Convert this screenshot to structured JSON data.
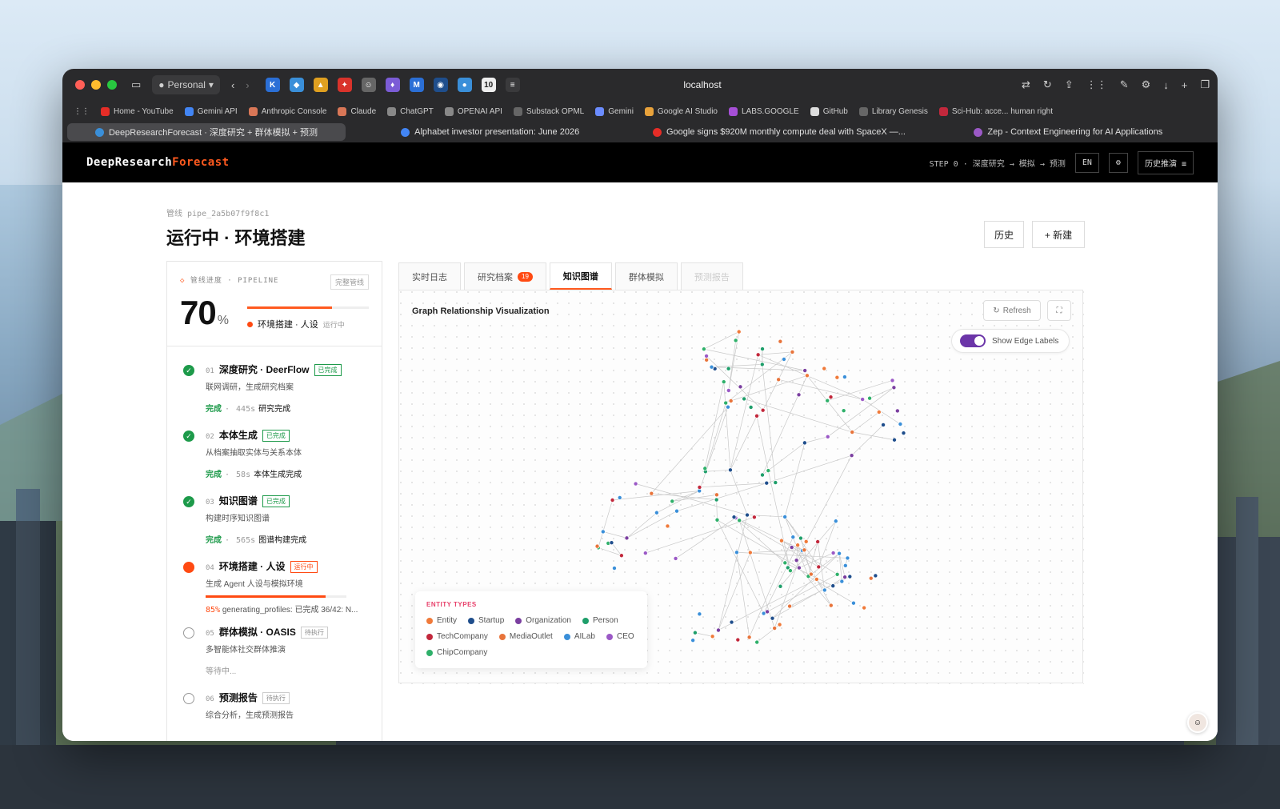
{
  "browser": {
    "profile": "Personal",
    "address": "localhost",
    "bookmarks": [
      "Home - YouTube",
      "Gemini API",
      "Anthropic Console",
      "Claude",
      "ChatGPT",
      "OPENAI API",
      "Substack OPML",
      "Gemini",
      "Google AI Studio",
      "LABS.GOOGLE",
      "GitHub",
      "Library Genesis",
      "Sci-Hub: acce... human right"
    ],
    "tabs": [
      "DeepResearchForecast · 深度研究 + 群体模拟 + 预测",
      "Alphabet investor presentation: June 2026",
      "Google signs $920M monthly compute deal with SpaceX —...",
      "Zep - Context Engineering for AI Applications"
    ]
  },
  "header": {
    "brand_a": "DeepResearch",
    "brand_b": "Forecast",
    "step": "STEP 0 · 深度研究 → 模拟 → 预测",
    "lang": "EN",
    "history_btn": "历史推演 ≡"
  },
  "page": {
    "pipe_id": "管线 pipe_2a5b07f9f8c1",
    "title": "运行中 · 环境搭建",
    "history": "历史",
    "new": "+  新建"
  },
  "pipeline": {
    "caption": "管线进度 · PIPELINE",
    "full_btn": "完整管线",
    "percent": "70",
    "percent_unit": "%",
    "progress_fraction": 0.7,
    "current": "环境搭建 · 人设",
    "current_status": "运行中",
    "steps": [
      {
        "num": "01",
        "title": "深度研究 · DeerFlow",
        "badge": "已完成",
        "desc": "联网调研，生成研究档案",
        "status": "完成",
        "secs": "445s",
        "note": "研究完成"
      },
      {
        "num": "02",
        "title": "本体生成",
        "badge": "已完成",
        "desc": "从档案抽取实体与关系本体",
        "status": "完成",
        "secs": "58s",
        "note": "本体生成完成"
      },
      {
        "num": "03",
        "title": "知识图谱",
        "badge": "已完成",
        "desc": "构建时序知识图谱",
        "status": "完成",
        "secs": "565s",
        "note": "图谱构建完成"
      },
      {
        "num": "04",
        "title": "环境搭建 · 人设",
        "badge": "运行中",
        "desc": "生成 Agent 人设与模拟环境",
        "pct": "85%",
        "progress_fraction": 0.85,
        "note": "generating_profiles: 已完成 36/42: N..."
      },
      {
        "num": "05",
        "title": "群体模拟 · OASIS",
        "badge": "待执行",
        "desc": "多智能体社交群体推演",
        "wait": "等待中..."
      },
      {
        "num": "06",
        "title": "预测报告",
        "badge": "待执行",
        "desc": "综合分析，生成预测报告"
      }
    ]
  },
  "panel": {
    "tabs": [
      "实时日志",
      "研究档案",
      "知识图谱",
      "群体模拟",
      "预测报告"
    ],
    "badge_count": "19",
    "graph_title": "Graph Relationship Visualization",
    "refresh": "Refresh",
    "edge_labels": "Show Edge Labels",
    "legend_title": "ENTITY TYPES",
    "legend": [
      {
        "name": "Entity",
        "color": "#f07a3a"
      },
      {
        "name": "Startup",
        "color": "#1f4e8c"
      },
      {
        "name": "Organization",
        "color": "#7b3fa0"
      },
      {
        "name": "Person",
        "color": "#1e9e6a"
      },
      {
        "name": "TechCompany",
        "color": "#c2283c"
      },
      {
        "name": "MediaOutlet",
        "color": "#e8743b"
      },
      {
        "name": "AILab",
        "color": "#3a8fd9"
      },
      {
        "name": "CEO",
        "color": "#9b59c6"
      },
      {
        "name": "ChipCompany",
        "color": "#2fb06a"
      }
    ]
  },
  "colors": {
    "accent": "#ff5a1f",
    "done": "#1d9a4a",
    "running": "#ff4a12",
    "toggle": "#6b35a8"
  }
}
